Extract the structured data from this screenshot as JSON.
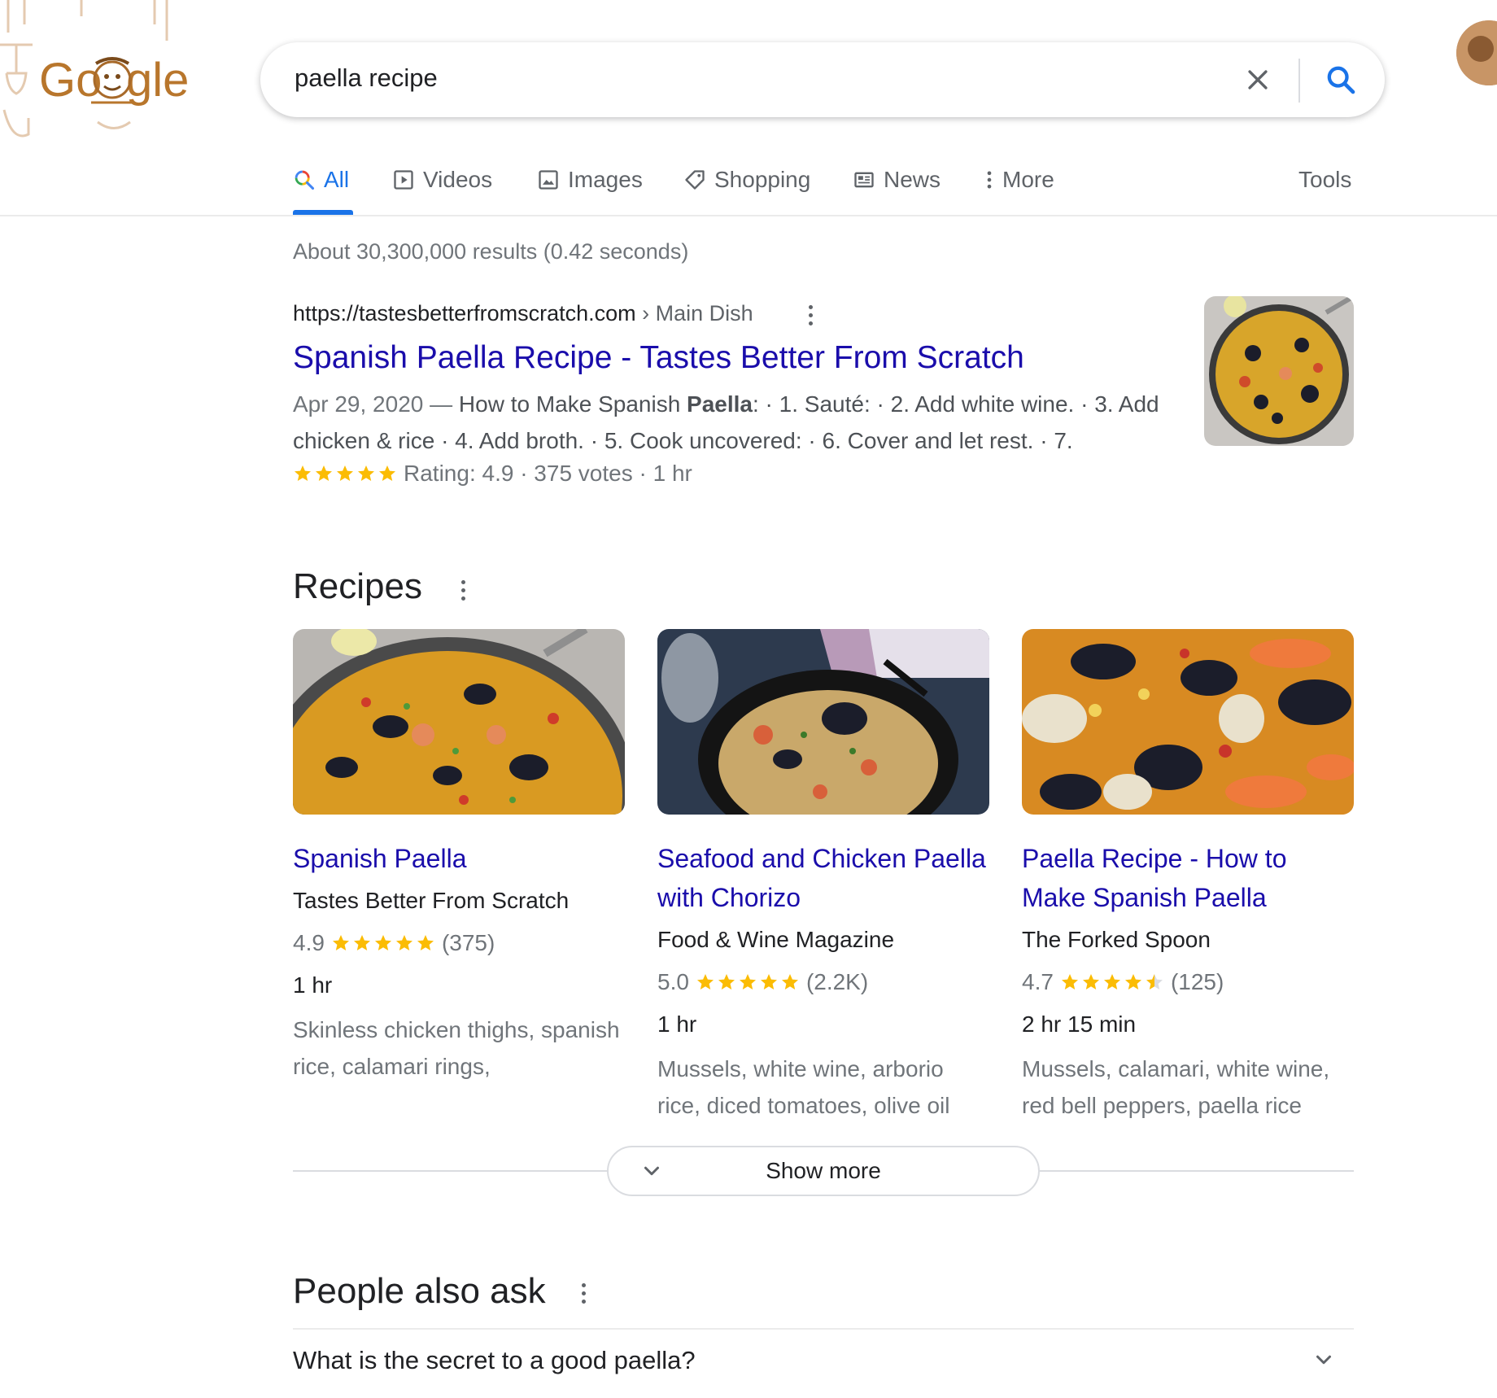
{
  "search": {
    "query": "paella recipe"
  },
  "tabs": [
    {
      "label": "All",
      "icon": "search-icon",
      "active": true
    },
    {
      "label": "Videos",
      "icon": "play-icon"
    },
    {
      "label": "Images",
      "icon": "image-icon"
    },
    {
      "label": "Shopping",
      "icon": "tag-icon"
    },
    {
      "label": "News",
      "icon": "newspaper-icon"
    },
    {
      "label": "More",
      "icon": "dots-vertical-icon"
    }
  ],
  "tools_label": "Tools",
  "result_stats": "About 30,300,000 results (0.42 seconds)",
  "result": {
    "url": "https://tastesbetterfromscratch.com",
    "path": " › Main Dish",
    "title": "Spanish Paella Recipe - Tastes Better From Scratch",
    "date": "Apr 29, 2020 — ",
    "snippet_a": "How to Make Spanish ",
    "snippet_bold": "Paella",
    "snippet_b": ": · 1. Sauté: · 2. Add white wine. · 3. Add chicken & rice · 4. Add broth. · 5. Cook uncovered: · 6. Cover and let rest. · 7.",
    "rating_text": "Rating: 4.9 · 375 votes · 1 hr",
    "rating": 4.9
  },
  "recipes": {
    "title": "Recipes",
    "cards": [
      {
        "title": "Spanish Paella",
        "source": "Tastes Better From Scratch",
        "rating": "4.9",
        "rating_value": 4.9,
        "count": "(375)",
        "time": "1 hr",
        "ingredients": "Skinless chicken thighs, spanish rice, calamari rings,"
      },
      {
        "title": "Seafood and Chicken Paella with Chorizo",
        "source": "Food & Wine Magazine",
        "rating": "5.0",
        "rating_value": 5.0,
        "count": "(2.2K)",
        "time": "1 hr",
        "ingredients": "Mussels, white wine, arborio rice, diced tomatoes, olive oil"
      },
      {
        "title": "Paella Recipe - How to Make Spanish Paella",
        "source": "The Forked Spoon",
        "rating": "4.7",
        "rating_value": 4.7,
        "count": "(125)",
        "time": "2 hr 15 min",
        "ingredients": "Mussels, calamari, white wine, red bell peppers, paella rice"
      }
    ],
    "show_more": "Show more"
  },
  "people_also_ask": {
    "title": "People also ask",
    "questions": [
      "What is the secret to a good paella?"
    ]
  },
  "colors": {
    "link": "#1a0dab",
    "accent": "#1a73e8",
    "star": "#fbbc04"
  }
}
